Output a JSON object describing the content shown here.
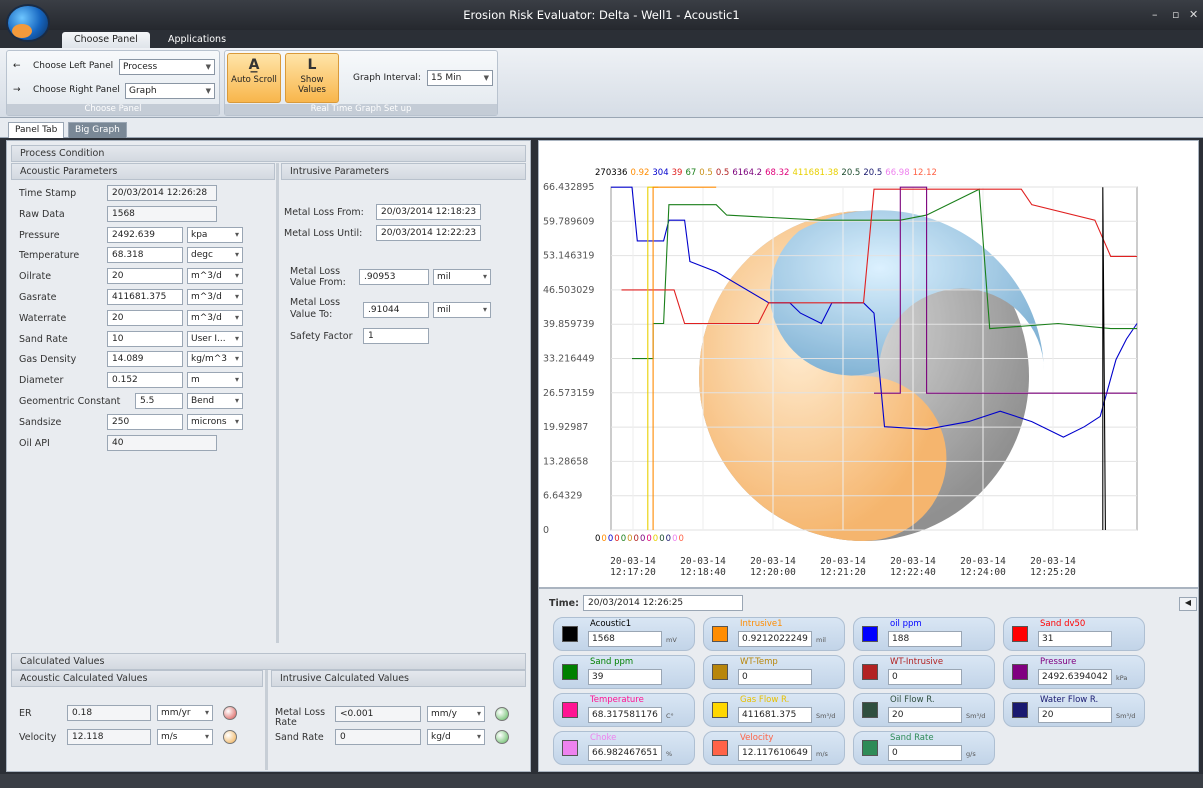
{
  "window": {
    "title": "Erosion Risk Evaluator: Delta - Well1 - Acoustic1",
    "min": "–",
    "max": "▫",
    "close": "✕"
  },
  "ribbon_tabs": [
    "Choose Panel",
    "Applications"
  ],
  "ribbon": {
    "left_panel_label": "Choose Left Panel",
    "left_panel_value": "Process",
    "right_panel_label": "Choose Right Panel",
    "right_panel_value": "Graph",
    "group1_label": "Choose Panel",
    "auto_scroll": "Auto Scroll",
    "show_values": "Show Values",
    "graph_interval_label": "Graph Interval:",
    "graph_interval_value": "15 Min",
    "group2_label": "Real Time Graph Set up"
  },
  "sub_tabs": [
    "Panel Tab",
    "Big Graph"
  ],
  "process": {
    "title": "Process Condition",
    "acoustic_header": "Acoustic Parameters",
    "intrusive_header": "Intrusive Parameters",
    "acoustic_rows": [
      {
        "label": "Time Stamp",
        "value": "20/03/2014 12:26:28",
        "unit": ""
      },
      {
        "label": "Raw Data",
        "value": "1568",
        "unit": ""
      },
      {
        "label": "Pressure",
        "value": "2492.639",
        "unit": "kpa"
      },
      {
        "label": "Temperature",
        "value": "68.318",
        "unit": "degc"
      },
      {
        "label": "Oilrate",
        "value": "20",
        "unit": "m^3/d"
      },
      {
        "label": "Gasrate",
        "value": "411681.375",
        "unit": "m^3/d"
      },
      {
        "label": "Waterrate",
        "value": "20",
        "unit": "m^3/d"
      },
      {
        "label": "Sand Rate",
        "value": "10",
        "unit": "User I..."
      },
      {
        "label": "Gas Density",
        "value": "14.089",
        "unit": "kg/m^3"
      },
      {
        "label": "Diameter",
        "value": "0.152",
        "unit": "m"
      },
      {
        "label": "Geomentric Constant",
        "value": "5.5",
        "unit": "Bend"
      },
      {
        "label": "Sandsize",
        "value": "250",
        "unit": "microns"
      },
      {
        "label": "Oil API",
        "value": "40",
        "unit": ""
      }
    ],
    "metal_loss_from_label": "Metal Loss From:",
    "metal_loss_from": "20/03/2014 12:18:23",
    "metal_loss_until_label": "Metal Loss Until:",
    "metal_loss_until": "20/03/2014 12:22:23",
    "ml_value_from_label1": "Metal Loss",
    "ml_value_from_label2": "Value From:",
    "ml_value_from": ".90953",
    "ml_value_from_unit": "mil",
    "ml_value_to_label1": "Metal Loss",
    "ml_value_to_label2": "Value To:",
    "ml_value_to": ".91044",
    "ml_value_to_unit": "mil",
    "safety_factor_label": "Safety Factor",
    "safety_factor": "1"
  },
  "calculated": {
    "title": "Calculated Values",
    "acoustic_header": "Acoustic Calculated Values",
    "intrusive_header": "Intrusive Calculated Values",
    "er_label": "ER",
    "er_value": "0.18",
    "er_unit": "mm/yr",
    "velocity_label": "Velocity",
    "velocity_value": "12.118",
    "velocity_unit": "m/s",
    "ml_rate_label1": "Metal Loss",
    "ml_rate_label2": "Rate",
    "ml_rate_value": "<0.001",
    "ml_rate_unit": "mm/y",
    "sand_rate_label": "Sand Rate",
    "sand_rate_value": "0",
    "sand_rate_unit": "kg/d",
    "colors": {
      "er_led": "#d9534f",
      "velocity_led": "#f0ad4e",
      "ml_led": "#5cb85c",
      "sand_led": "#5cb85c"
    }
  },
  "graph": {
    "header_values": [
      {
        "text": "270336",
        "color": "#000000"
      },
      {
        "text": "0.92",
        "color": "#ff8c00"
      },
      {
        "text": "304",
        "color": "#0000cc"
      },
      {
        "text": "39",
        "color": "#e02020"
      },
      {
        "text": "67",
        "color": "#1a7f1a"
      },
      {
        "text": "0.5",
        "color": "#c8901a"
      },
      {
        "text": "0.5",
        "color": "#b22222"
      },
      {
        "text": "6164.2",
        "color": "#7b007b"
      },
      {
        "text": "68.32",
        "color": "#e0007a"
      },
      {
        "text": "411681.38",
        "color": "#e8d000"
      },
      {
        "text": "20.5",
        "color": "#1f4d2f"
      },
      {
        "text": "20.5",
        "color": "#1a1a6e"
      },
      {
        "text": "66.98",
        "color": "#ee82ee"
      },
      {
        "text": "12.12",
        "color": "#ff6347"
      }
    ],
    "bottom_zeros": [
      {
        "text": "0",
        "color": "#000000"
      },
      {
        "text": "0",
        "color": "#ff8c00"
      },
      {
        "text": "0",
        "color": "#0000cc"
      },
      {
        "text": "0",
        "color": "#e02020"
      },
      {
        "text": "0",
        "color": "#1a7f1a"
      },
      {
        "text": "0",
        "color": "#c8901a"
      },
      {
        "text": "0",
        "color": "#b22222"
      },
      {
        "text": "0",
        "color": "#7b007b"
      },
      {
        "text": "0",
        "color": "#e0007a"
      },
      {
        "text": "0",
        "color": "#e8d000"
      },
      {
        "text": "0",
        "color": "#1f4d2f"
      },
      {
        "text": "0",
        "color": "#1a1a6e"
      },
      {
        "text": "0",
        "color": "#ee82ee"
      },
      {
        "text": "0",
        "color": "#ff6347"
      }
    ],
    "time_label": "Time:",
    "time_value": "20/03/2014 12:26:25"
  },
  "chart_data": {
    "type": "line",
    "yticks": [
      "66.432895",
      "59.789609",
      "53.146319",
      "46.503029",
      "39.859739",
      "33.216449",
      "26.573159",
      "19.92987",
      "13.28658",
      "6.64329",
      "0"
    ],
    "ylim": [
      0,
      66.432895
    ],
    "xticks": [
      {
        "d": "20-03-14",
        "t": "12:17:20"
      },
      {
        "d": "20-03-14",
        "t": "12:18:40"
      },
      {
        "d": "20-03-14",
        "t": "12:20:00"
      },
      {
        "d": "20-03-14",
        "t": "12:21:20"
      },
      {
        "d": "20-03-14",
        "t": "12:22:40"
      },
      {
        "d": "20-03-14",
        "t": "12:24:00"
      },
      {
        "d": "20-03-14",
        "t": "12:25:20"
      }
    ],
    "series": [
      {
        "color": "#0000cc",
        "points": [
          [
            0,
            66.4
          ],
          [
            0.04,
            66.4
          ],
          [
            0.05,
            56
          ],
          [
            0.1,
            56
          ],
          [
            0.11,
            60
          ],
          [
            0.14,
            60
          ],
          [
            0.15,
            52
          ],
          [
            0.2,
            50
          ],
          [
            0.3,
            44
          ],
          [
            0.34,
            44
          ],
          [
            0.36,
            42
          ],
          [
            0.4,
            40
          ],
          [
            0.42,
            44
          ],
          [
            0.48,
            44
          ],
          [
            0.5,
            42
          ],
          [
            0.52,
            20
          ],
          [
            0.6,
            19.5
          ],
          [
            0.68,
            21
          ],
          [
            0.74,
            23
          ],
          [
            0.8,
            21
          ],
          [
            0.86,
            18
          ],
          [
            0.9,
            20
          ],
          [
            0.93,
            22
          ],
          [
            0.96,
            33
          ],
          [
            0.98,
            37
          ],
          [
            1,
            40
          ]
        ]
      },
      {
        "color": "#1a7f1a",
        "points": [
          [
            0.04,
            33.2
          ],
          [
            0.08,
            33.2
          ],
          [
            0.08,
            40
          ],
          [
            0.1,
            40
          ],
          [
            0.11,
            63
          ],
          [
            0.2,
            63
          ],
          [
            0.22,
            61
          ],
          [
            0.4,
            60
          ],
          [
            0.55,
            60
          ],
          [
            0.6,
            61
          ],
          [
            0.7,
            66
          ],
          [
            0.72,
            39
          ],
          [
            0.85,
            40
          ],
          [
            0.95,
            39
          ],
          [
            1,
            39
          ]
        ]
      },
      {
        "color": "#e02020",
        "points": [
          [
            0.02,
            46.5
          ],
          [
            0.12,
            46.5
          ],
          [
            0.14,
            40
          ],
          [
            0.28,
            40
          ],
          [
            0.3,
            44
          ],
          [
            0.48,
            44
          ],
          [
            0.5,
            66
          ],
          [
            0.78,
            66
          ],
          [
            0.8,
            63
          ],
          [
            0.92,
            60
          ],
          [
            0.95,
            53
          ],
          [
            1,
            53
          ]
        ]
      },
      {
        "color": "#7b007b",
        "points": [
          [
            0.5,
            26.5
          ],
          [
            0.55,
            26.5
          ],
          [
            0.55,
            66.4
          ],
          [
            0.6,
            66.4
          ],
          [
            0.6,
            26.5
          ],
          [
            1,
            26.5
          ]
        ]
      },
      {
        "color": "#e8d000",
        "points": [
          [
            0.07,
            0
          ],
          [
            0.07,
            66.4
          ],
          [
            0.09,
            66.4
          ]
        ]
      },
      {
        "color": "#ff8c00",
        "points": [
          [
            0.08,
            0
          ],
          [
            0.08,
            66.4
          ],
          [
            0.2,
            66.4
          ]
        ]
      },
      {
        "color": "#000000",
        "points": [
          [
            0.935,
            0
          ],
          [
            0.935,
            66.4
          ],
          [
            0.94,
            0
          ]
        ]
      }
    ]
  },
  "legend": [
    {
      "name": "Acoustic1",
      "value": "1568",
      "unit": "mV",
      "color": "#000000",
      "text_color": "#000000"
    },
    {
      "name": "Intrusive1",
      "value": "0.9212022249",
      "unit": "mil",
      "color": "#ff8c00",
      "text_color": "#ff8c00"
    },
    {
      "name": "oil ppm",
      "value": "188",
      "unit": "",
      "color": "#0000ff",
      "text_color": "#0000ff"
    },
    {
      "name": "Sand dv50",
      "value": "31",
      "unit": "",
      "color": "#ff0000",
      "text_color": "#ff0000"
    },
    {
      "name": "Sand ppm",
      "value": "39",
      "unit": "",
      "color": "#008000",
      "text_color": "#008000"
    },
    {
      "name": "WT-Temp",
      "value": "0",
      "unit": "",
      "color": "#b8860b",
      "text_color": "#b8860b"
    },
    {
      "name": "WT-Intrusive",
      "value": "0",
      "unit": "",
      "color": "#b22222",
      "text_color": "#b22222"
    },
    {
      "name": "Pressure",
      "value": "2492.6394042",
      "unit": "kPa",
      "color": "#800080",
      "text_color": "#800080"
    },
    {
      "name": "Temperature",
      "value": "68.317581176",
      "unit": "C°",
      "color": "#ff1493",
      "text_color": "#ff1493"
    },
    {
      "name": "Gas Flow R.",
      "value": "411681.375",
      "unit": "Sm³/d",
      "color": "#ffd700",
      "text_color": "#e8c000"
    },
    {
      "name": "Oil Flow R.",
      "value": "20",
      "unit": "Sm³/d",
      "color": "#2f4f3f",
      "text_color": "#2f4f3f"
    },
    {
      "name": "Water Flow R.",
      "value": "20",
      "unit": "Sm³/d",
      "color": "#191970",
      "text_color": "#191970"
    },
    {
      "name": "Choke",
      "value": "66.982467651",
      "unit": "%",
      "color": "#ee82ee",
      "text_color": "#ee82ee"
    },
    {
      "name": "Velocity",
      "value": "12.117610649",
      "unit": "m/s",
      "color": "#ff6347",
      "text_color": "#ff6347"
    },
    {
      "name": "Sand Rate",
      "value": "0",
      "unit": "g/s",
      "color": "#2e8b57",
      "text_color": "#2e8b57"
    }
  ],
  "icons": {
    "left_arrow": "←",
    "right_arrow": "→",
    "restore": "◀"
  }
}
